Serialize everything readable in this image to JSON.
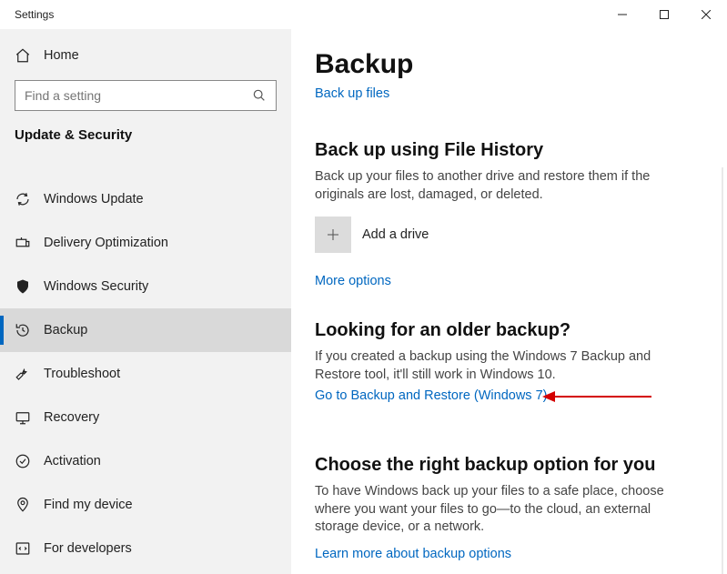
{
  "titlebar": {
    "title": "Settings"
  },
  "home": {
    "label": "Home"
  },
  "search": {
    "placeholder": "Find a setting"
  },
  "section": {
    "title": "Update & Security"
  },
  "nav": {
    "items": [
      {
        "label": "Windows Update"
      },
      {
        "label": "Delivery Optimization"
      },
      {
        "label": "Windows Security"
      },
      {
        "label": "Backup",
        "selected": true
      },
      {
        "label": "Troubleshoot"
      },
      {
        "label": "Recovery"
      },
      {
        "label": "Activation"
      },
      {
        "label": "Find my device"
      },
      {
        "label": "For developers"
      }
    ]
  },
  "page": {
    "title": "Backup",
    "backup_files_link": "Back up files",
    "fh_heading": "Back up using File History",
    "fh_body": "Back up your files to another drive and restore them if the originals are lost, damaged, or deleted.",
    "add_drive_label": "Add a drive",
    "more_options": "More options",
    "older_heading": "Looking for an older backup?",
    "older_body": "If you created a backup using the Windows 7 Backup and Restore tool, it'll still work in Windows 10.",
    "older_link": "Go to Backup and Restore (Windows 7)",
    "choose_heading": "Choose the right backup option for you",
    "choose_body": "To have Windows back up your files to a safe place, choose where you want your files to go—to the cloud, an external storage device, or a network.",
    "choose_link": "Learn more about backup options"
  }
}
